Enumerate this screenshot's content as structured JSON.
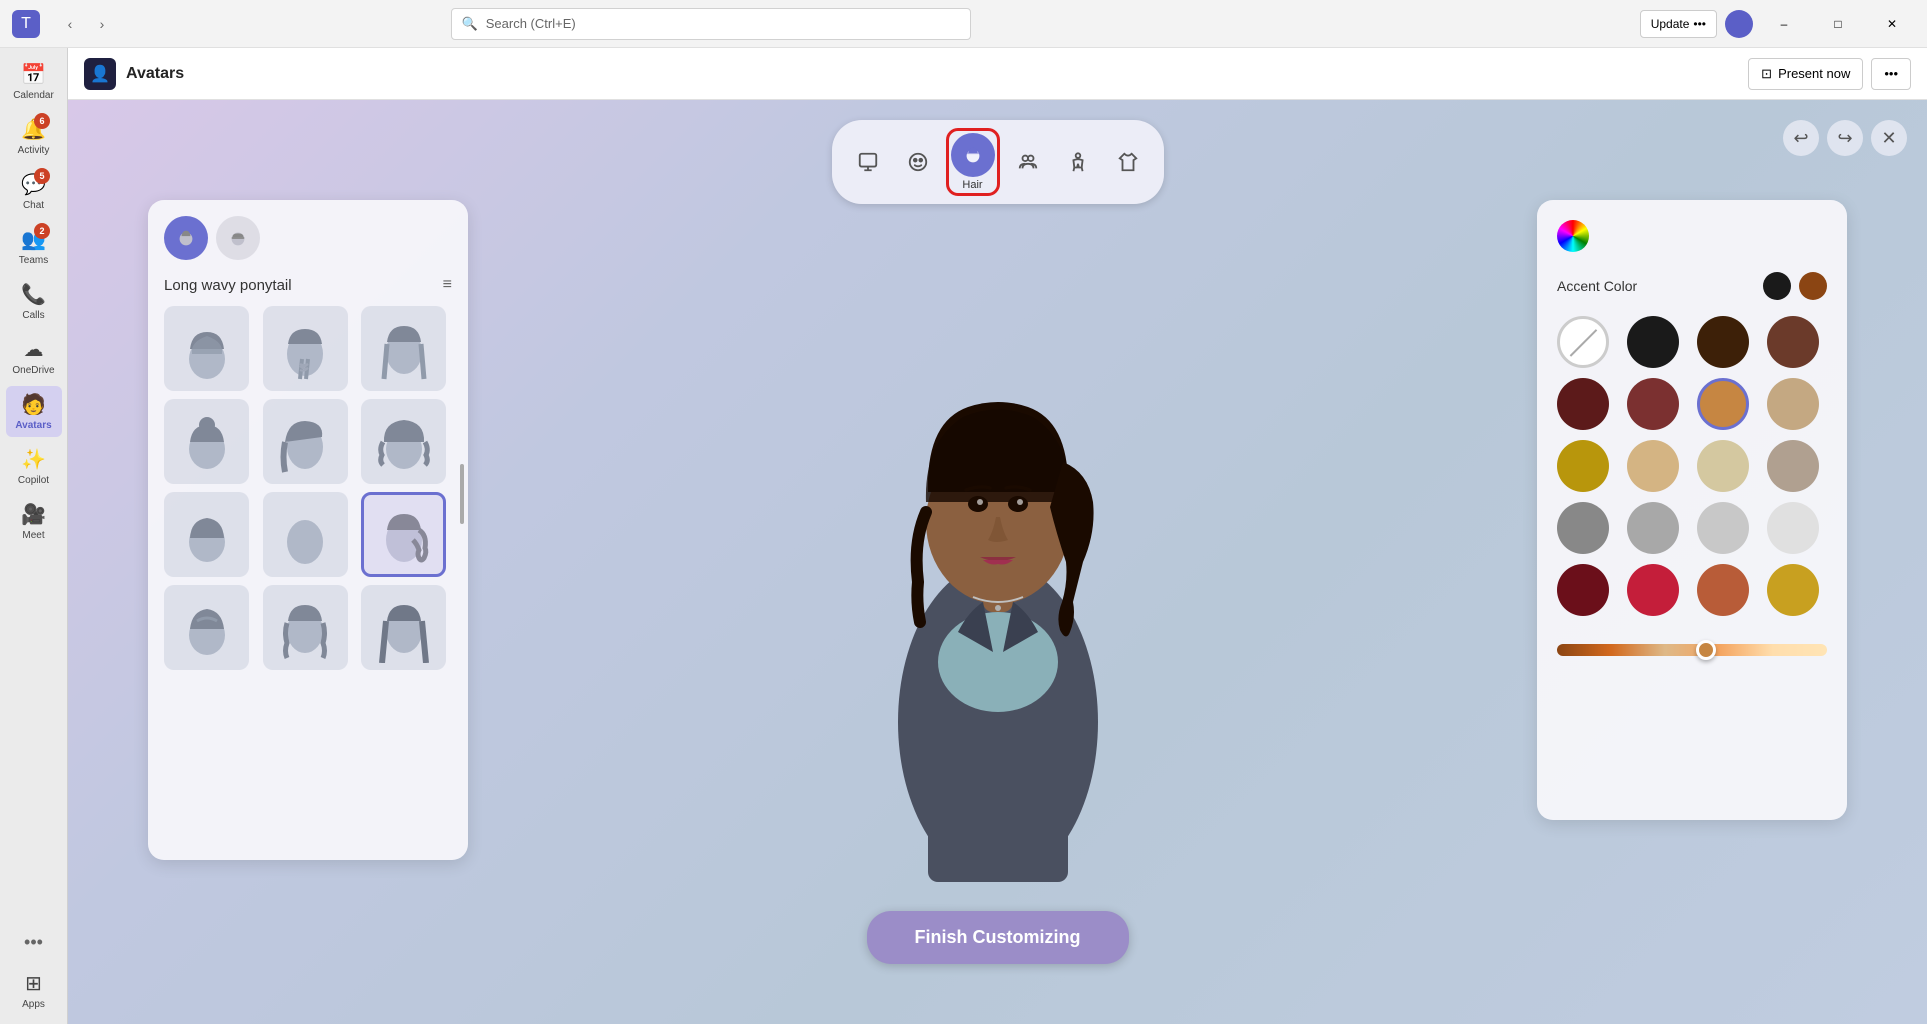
{
  "titleBar": {
    "searchPlaceholder": "Search (Ctrl+E)",
    "updateLabel": "Update",
    "updateDots": "•••",
    "minimizeLabel": "–",
    "maximizeLabel": "□",
    "closeLabel": "✕"
  },
  "sidebar": {
    "items": [
      {
        "id": "calendar",
        "label": "Calendar",
        "icon": "📅",
        "badge": null,
        "active": false
      },
      {
        "id": "activity",
        "label": "Activity",
        "icon": "🔔",
        "badge": "6",
        "active": false
      },
      {
        "id": "chat",
        "label": "Chat",
        "icon": "💬",
        "badge": "5",
        "active": false
      },
      {
        "id": "teams",
        "label": "Teams",
        "icon": "👥",
        "badge": "2",
        "active": false
      },
      {
        "id": "calls",
        "label": "Calls",
        "icon": "📞",
        "badge": null,
        "active": false
      },
      {
        "id": "onedrive",
        "label": "OneDrive",
        "icon": "☁",
        "badge": null,
        "active": false
      },
      {
        "id": "avatars",
        "label": "Avatars",
        "icon": "🧑",
        "badge": null,
        "active": true
      },
      {
        "id": "copilot",
        "label": "Copilot",
        "icon": "✨",
        "badge": null,
        "active": false
      },
      {
        "id": "meet",
        "label": "Meet",
        "icon": "🎥",
        "badge": null,
        "active": false
      }
    ],
    "bottomItems": [
      {
        "id": "more",
        "label": "•••",
        "icon": "•••",
        "active": false
      },
      {
        "id": "apps",
        "label": "Apps",
        "icon": "⊞",
        "active": false
      }
    ]
  },
  "appHeader": {
    "iconLabel": "A",
    "title": "Avatars",
    "presentNowLabel": "Present now",
    "moreLabel": "•••"
  },
  "toolbar": {
    "buttons": [
      {
        "id": "scene",
        "icon": "🎬",
        "label": "",
        "active": false
      },
      {
        "id": "face",
        "icon": "😊",
        "label": "",
        "active": false
      },
      {
        "id": "hair",
        "icon": "👤",
        "label": "Hair",
        "active": true,
        "selected": true
      },
      {
        "id": "group",
        "icon": "👥",
        "label": "",
        "active": false
      },
      {
        "id": "body",
        "icon": "🧍",
        "label": "",
        "active": false
      },
      {
        "id": "outfit",
        "icon": "👕",
        "label": "",
        "active": false
      }
    ],
    "rightButtons": [
      {
        "id": "undo",
        "icon": "↩",
        "label": ""
      },
      {
        "id": "redo",
        "icon": "↪",
        "label": ""
      },
      {
        "id": "close",
        "icon": "✕",
        "label": ""
      }
    ]
  },
  "hairPanel": {
    "tabs": [
      {
        "id": "hair",
        "icon": "👤",
        "active": true
      },
      {
        "id": "headwear",
        "icon": "🎩",
        "active": false
      }
    ],
    "title": "Long wavy ponytail",
    "filterIcon": "≡",
    "items": [
      {
        "id": "h1",
        "selected": false,
        "type": "wavy-short"
      },
      {
        "id": "h2",
        "selected": false,
        "type": "braided"
      },
      {
        "id": "h3",
        "selected": false,
        "type": "straight-long"
      },
      {
        "id": "h4",
        "selected": false,
        "type": "bun"
      },
      {
        "id": "h5",
        "selected": false,
        "type": "side-swept"
      },
      {
        "id": "h6",
        "selected": false,
        "type": "curly"
      },
      {
        "id": "h7",
        "selected": false,
        "type": "pixie"
      },
      {
        "id": "h8",
        "selected": false,
        "type": "bob"
      },
      {
        "id": "h9",
        "selected": true,
        "type": "ponytail-wavy"
      },
      {
        "id": "h10",
        "selected": false,
        "type": "updo"
      },
      {
        "id": "h11",
        "selected": false,
        "type": "long-waves"
      },
      {
        "id": "h12",
        "selected": false,
        "type": "long-straight"
      }
    ]
  },
  "colorPanel": {
    "accentColorLabel": "Accent Color",
    "accentSwatches": [
      {
        "id": "black",
        "color": "#1a1a1a",
        "selected": false
      },
      {
        "id": "brown",
        "color": "#8B4513",
        "selected": false
      }
    ],
    "colors": [
      {
        "id": "none",
        "type": "none",
        "color": null,
        "selected": false
      },
      {
        "id": "black",
        "color": "#1a1a1a",
        "selected": false
      },
      {
        "id": "dark-brown",
        "color": "#3d2008",
        "selected": false
      },
      {
        "id": "medium-brown",
        "color": "#6B3A2A",
        "selected": false
      },
      {
        "id": "dark-red-brown",
        "color": "#5C1A1A",
        "selected": false
      },
      {
        "id": "red-brown",
        "color": "#7B3030",
        "selected": false
      },
      {
        "id": "caramel",
        "color": "#C68642",
        "selected": true
      },
      {
        "id": "light-brown",
        "color": "#C4A882",
        "selected": false
      },
      {
        "id": "golden",
        "color": "#B8960C",
        "selected": false
      },
      {
        "id": "sandy",
        "color": "#D4B483",
        "selected": false
      },
      {
        "id": "light-golden",
        "color": "#D4C8A0",
        "selected": false
      },
      {
        "id": "silver-brown",
        "color": "#B0A090",
        "selected": false
      },
      {
        "id": "gray",
        "color": "#888888",
        "selected": false
      },
      {
        "id": "light-gray",
        "color": "#A8A8A8",
        "selected": false
      },
      {
        "id": "silver",
        "color": "#C8C8C8",
        "selected": false
      },
      {
        "id": "white",
        "color": "#E8E8E8",
        "selected": false
      },
      {
        "id": "dark-red",
        "color": "#6B0F1A",
        "selected": false
      },
      {
        "id": "red",
        "color": "#C41E3A",
        "selected": false
      },
      {
        "id": "copper",
        "color": "#B85C38",
        "selected": false
      },
      {
        "id": "gold-yellow",
        "color": "#C8A020",
        "selected": false
      }
    ],
    "sliderValue": 55
  },
  "finishButton": {
    "label": "Finish Customizing"
  }
}
